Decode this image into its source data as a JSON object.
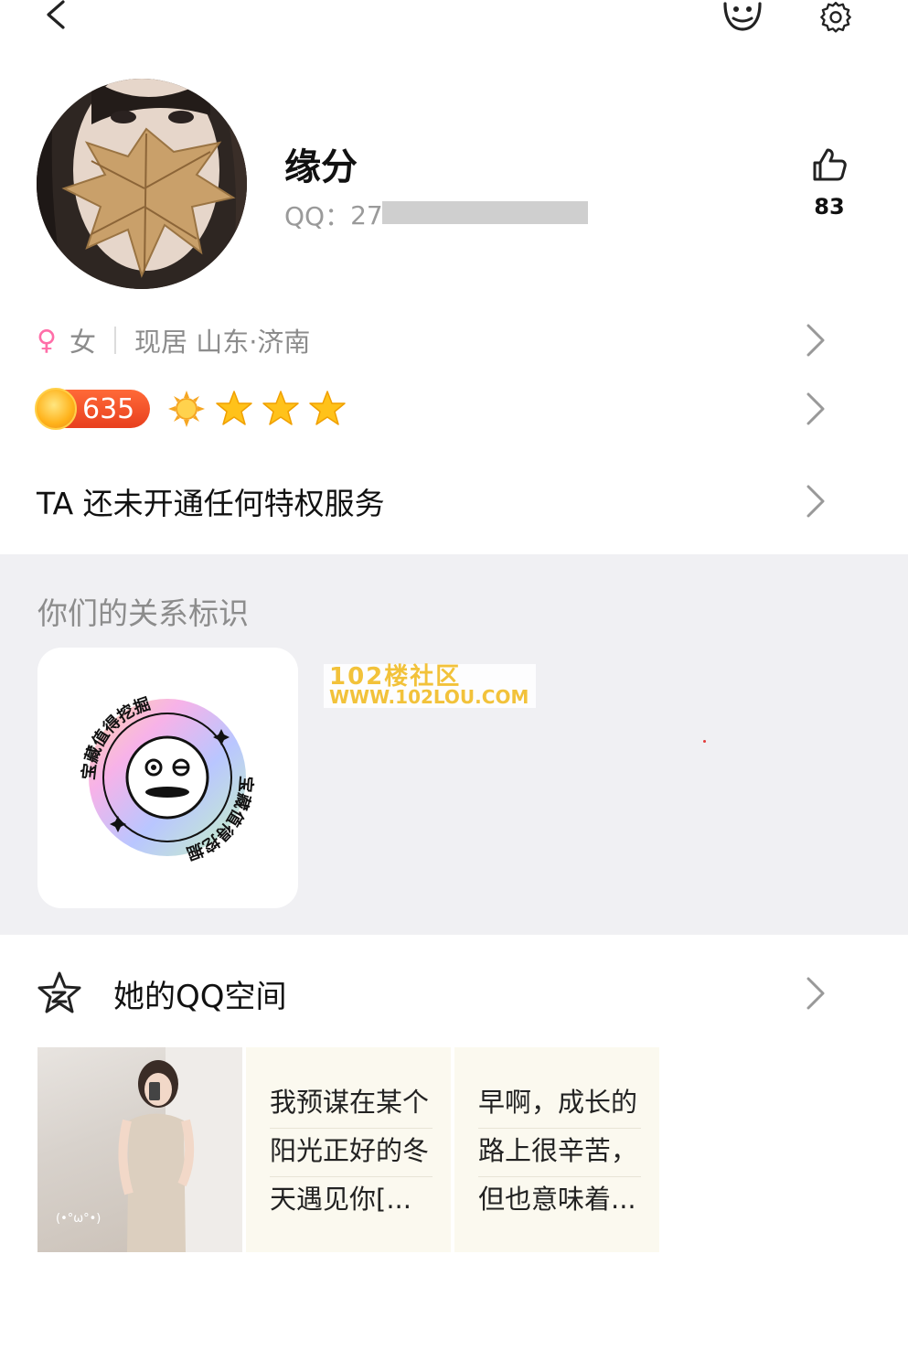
{
  "topbar": {
    "back_icon": "chevron-left-icon",
    "mascot_icon": "penguin-mascot-icon",
    "settings_icon": "gear-icon"
  },
  "profile": {
    "nickname": "缘分",
    "qq_label": "QQ：",
    "qq_number_visible": "27",
    "like_count": "83"
  },
  "info": {
    "gender_icon": "female-symbol-icon",
    "gender": "女",
    "location": "现居 山东·济南"
  },
  "level": {
    "value": "635",
    "icons": [
      "sun-icon",
      "star-icon",
      "star-icon",
      "star-icon"
    ]
  },
  "privilege": {
    "text": "TA 还未开通任何特权服务"
  },
  "relationship": {
    "title": "你们的关系标识",
    "badge_ring_text": "宝藏值得挖掘"
  },
  "watermark": {
    "line1": "102楼社区",
    "line2": "WWW.102LOU.COM"
  },
  "qzone": {
    "title": "她的QQ空间",
    "photo_caption": "(•°ω°•)",
    "posts": [
      {
        "lines": [
          "我预谋在某个",
          "阳光正好的冬",
          "天遇见你[..."
        ]
      },
      {
        "lines": [
          "早啊，成长的",
          "路上很辛苦，",
          "但也意味着..."
        ]
      }
    ]
  },
  "colors": {
    "accent_female": "#ff6ea8",
    "level_badge": "#e8401e",
    "section_bg": "#f0f0f3",
    "muted_text": "#8c8c8c"
  }
}
